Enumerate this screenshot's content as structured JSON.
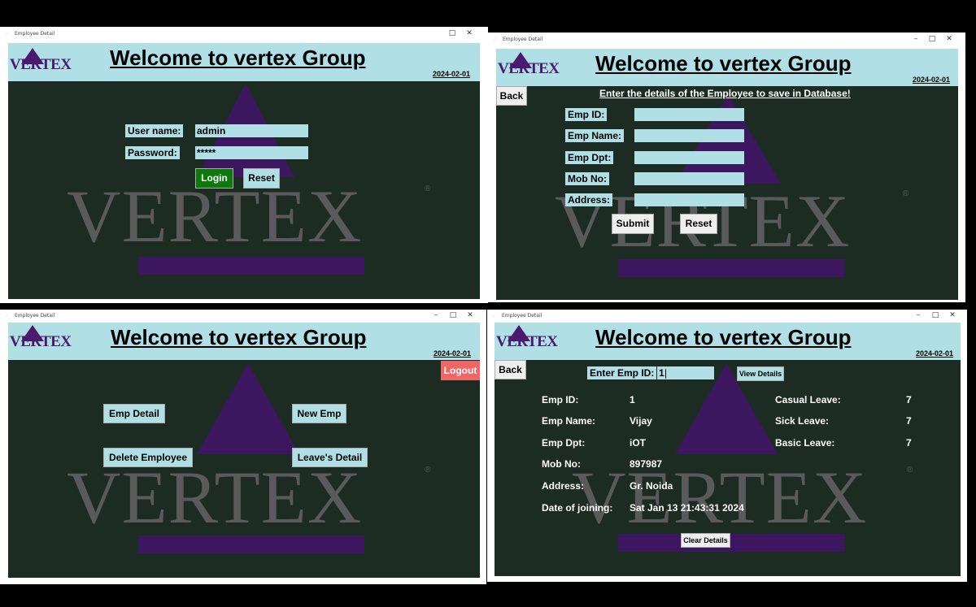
{
  "window_title": "Employee Detail",
  "window_controls": {
    "minimize": "–",
    "maximize": "□",
    "close": "✕"
  },
  "brand": {
    "logo_text": "VERTEX",
    "title": "Welcome to vertex Group",
    "date": "2024-02-01",
    "watermark": "VERTEX",
    "registered": "®"
  },
  "colors": {
    "header_bg": "#b0e0e6",
    "body_bg": "#1c2c22",
    "brand_purple": "#4a1a6e",
    "login_green": "#0b7a0b",
    "logout_red": "#f06666"
  },
  "login": {
    "username_label": "User name:",
    "username_value": "admin",
    "password_label": "Password:",
    "password_value": "*****",
    "login_button": "Login",
    "reset_button": "Reset"
  },
  "add_employee": {
    "back_button": "Back",
    "instruction": "Enter the details of the Employee to save in Database!",
    "fields": [
      {
        "label": "Emp ID:",
        "value": ""
      },
      {
        "label": "Emp Name:",
        "value": ""
      },
      {
        "label": "Emp Dpt:",
        "value": ""
      },
      {
        "label": "Mob No:",
        "value": ""
      },
      {
        "label": "Address:",
        "value": ""
      }
    ],
    "submit_button": "Submit",
    "reset_button": "Reset"
  },
  "dashboard": {
    "logout_button": "Logout",
    "emp_detail_button": "Emp Detail",
    "new_emp_button": "New Emp",
    "delete_employee_button": "Delete Employee",
    "leaves_detail_button": "Leave's Detail"
  },
  "view_details": {
    "back_button": "Back",
    "search_label": "Enter Emp ID:",
    "search_value": "1",
    "view_button": "View Details",
    "left": [
      {
        "label": "Emp ID:",
        "value": "1"
      },
      {
        "label": "Emp Name:",
        "value": "Vijay"
      },
      {
        "label": "Emp Dpt:",
        "value": "iOT"
      },
      {
        "label": "Mob No:",
        "value": "897987"
      },
      {
        "label": "Address:",
        "value": "Gr. Noida"
      },
      {
        "label": "Date of joining:",
        "value": "Sat Jan 13 21:43:31 2024"
      }
    ],
    "right": [
      {
        "label": "Casual Leave:",
        "value": "7"
      },
      {
        "label": "Sick Leave:",
        "value": "7"
      },
      {
        "label": "Basic Leave:",
        "value": "7"
      }
    ],
    "clear_button": "Clear Details"
  }
}
